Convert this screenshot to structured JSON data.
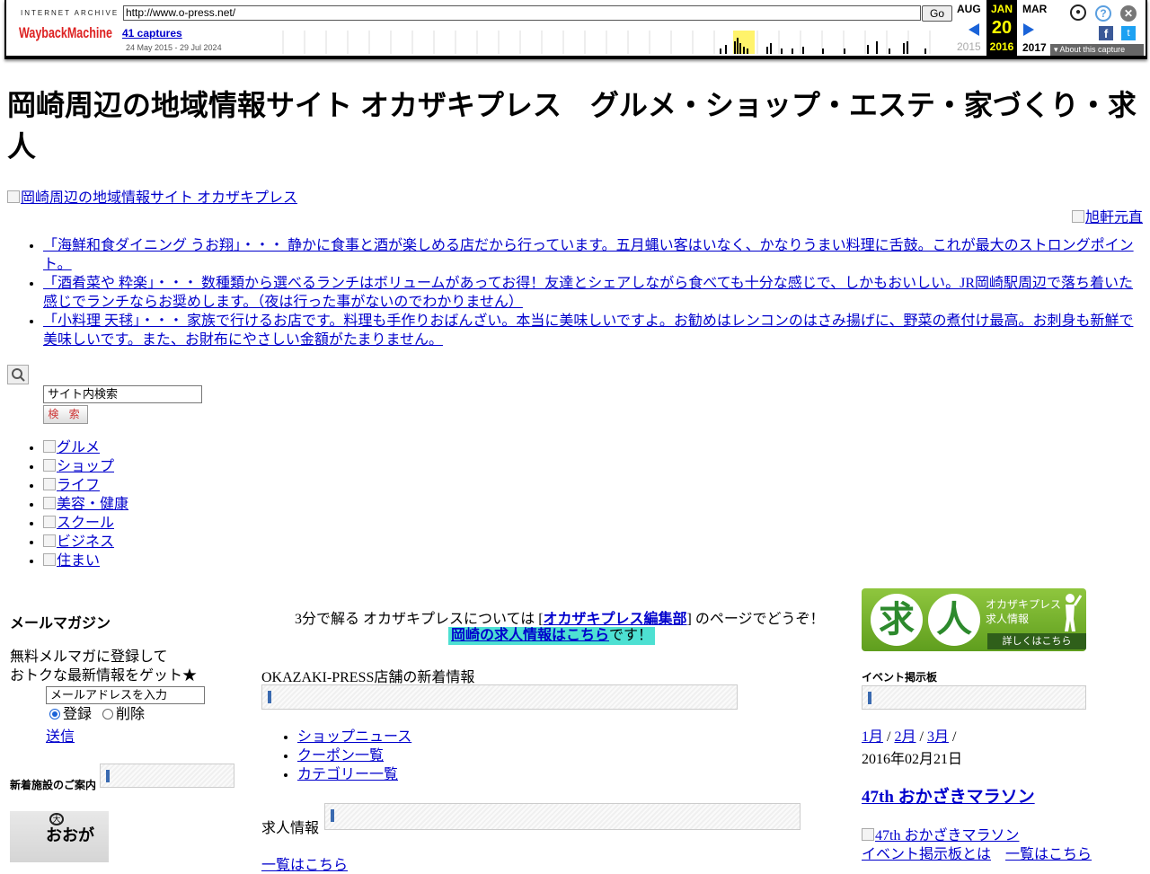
{
  "wayback": {
    "logo_top": "INTERNET ARCHIVE",
    "logo": "WaybackMachine",
    "url": "http://www.o-press.net/",
    "go": "Go",
    "captures": "41 captures",
    "range": "24 May 2015 - 29 Jul 2024",
    "prev_month": "AUG",
    "prev_year": "2015",
    "cur_month": "JAN",
    "cur_day": "20",
    "cur_year": "2016",
    "next_month": "MAR",
    "next_year": "2017",
    "about": "About this capture",
    "accent": "#ffff00"
  },
  "site": {
    "title": "岡崎周辺の地域情報サイト オカザキプレス　グルメ・ショップ・エステ・家づくり・求人",
    "logo_alt": "岡崎周辺の地域情報サイト オカザキプレス",
    "banner_alt": "旭軒元直"
  },
  "reviews": [
    "「海鮮和食ダイニング うお翔」・・・ 静かに食事と酒が楽しめる店だから行っています。五月蝿い客はいなく、かなりうまい料理に舌鼓。これが最大のストロングポイント。",
    "「酒肴菜や 粋楽」・・・ 数種類から選べるランチはボリュームがあってお得！友達とシェアしながら食べても十分な感じで、しかもおいしい。JR岡崎駅周辺で落ち着いた感じでランチならお奨めします。（夜は行った事がないのでわかりません）",
    "「小料理 天毬」・・・ 家族で行けるお店です。料理も手作りおばんざい。本当に美味しいですよ。お勧めはレンコンのはさみ揚げに、野菜の煮付け最高。お刺身も新鮮で美味しいです。また、お財布にやさしい金額がたまりません。"
  ],
  "search": {
    "value": "サイト内検索",
    "button": "検 索"
  },
  "categories": [
    "グルメ",
    "ショップ",
    "ライフ",
    "美容・健康",
    "スクール",
    "ビジネス",
    "住まい"
  ],
  "mailmag": {
    "title": "メールマガジン",
    "line1": "無料メルマガに登録して",
    "line2": "おトクな最新情報をゲット★",
    "email_value": "メールアドレスを入力",
    "register": "登録",
    "delete": "削除",
    "send": "送信",
    "new_facilities": "新着施設のご案内",
    "facility_text": "おおが"
  },
  "center": {
    "intro_before": "3分で解る オカザキプレスについては [",
    "intro_link": "オカザキプレス編集部",
    "intro_after": "] のページでどうぞ！",
    "job_link": "岡崎の求人情報はこちら",
    "job_after": "です！",
    "news_title": "OKAZAKI-PRESS店舗の新着情報",
    "links": [
      "ショップニュース",
      "クーポン一覧",
      "カテゴリー一覧"
    ],
    "job_label": "求人情報",
    "list_link": "一覧はこちら"
  },
  "right": {
    "banner_k1": "求",
    "banner_k2": "人",
    "banner_sub1": "オカザキプレス",
    "banner_sub2": "求人情報",
    "banner_detail": "詳しくはこちら",
    "event_title": "イベント掲示板",
    "months": [
      "1月",
      "2月",
      "3月"
    ],
    "event_date": "2016年02月21日",
    "event_name": "47th おかざきマラソン",
    "event_img_alt": "47th おかざきマラソン",
    "event_about": "イベント掲示板とは",
    "event_list": "一覧はこちら"
  }
}
